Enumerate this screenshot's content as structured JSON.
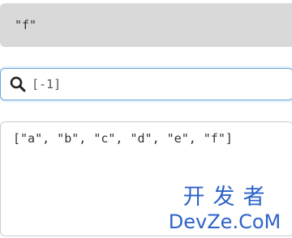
{
  "result": {
    "value": "\"f\""
  },
  "search": {
    "value": "[-1]",
    "icon": "search-icon"
  },
  "array": {
    "text": "[\"a\", \"b\", \"c\", \"d\", \"e\", \"f\"]"
  },
  "watermark": {
    "line1": "开发者",
    "line2": "DevZe.CoM",
    "color": "#2d63c8"
  }
}
